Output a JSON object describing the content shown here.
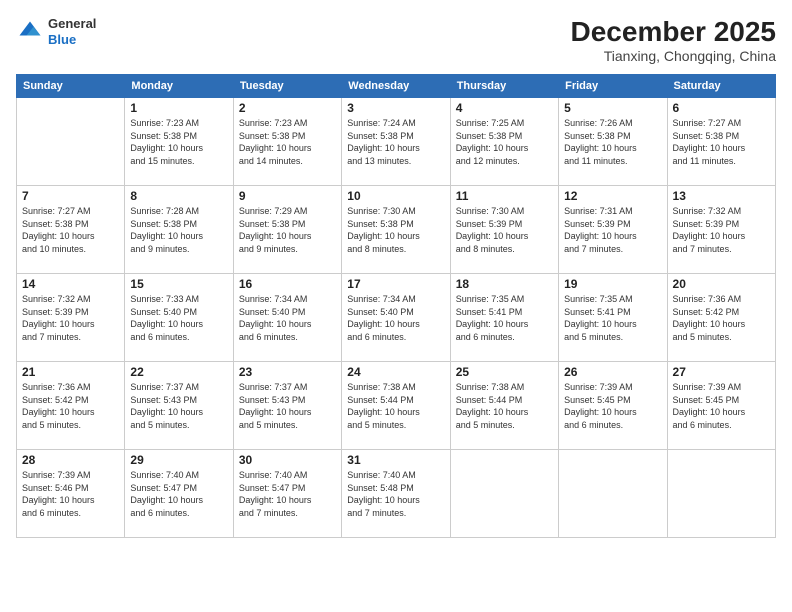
{
  "header": {
    "logo_line1": "General",
    "logo_line2": "Blue",
    "main_title": "December 2025",
    "sub_title": "Tianxing, Chongqing, China"
  },
  "days_of_week": [
    "Sunday",
    "Monday",
    "Tuesday",
    "Wednesday",
    "Thursday",
    "Friday",
    "Saturday"
  ],
  "weeks": [
    [
      {
        "day": "",
        "info": ""
      },
      {
        "day": "1",
        "info": "Sunrise: 7:23 AM\nSunset: 5:38 PM\nDaylight: 10 hours\nand 15 minutes."
      },
      {
        "day": "2",
        "info": "Sunrise: 7:23 AM\nSunset: 5:38 PM\nDaylight: 10 hours\nand 14 minutes."
      },
      {
        "day": "3",
        "info": "Sunrise: 7:24 AM\nSunset: 5:38 PM\nDaylight: 10 hours\nand 13 minutes."
      },
      {
        "day": "4",
        "info": "Sunrise: 7:25 AM\nSunset: 5:38 PM\nDaylight: 10 hours\nand 12 minutes."
      },
      {
        "day": "5",
        "info": "Sunrise: 7:26 AM\nSunset: 5:38 PM\nDaylight: 10 hours\nand 11 minutes."
      },
      {
        "day": "6",
        "info": "Sunrise: 7:27 AM\nSunset: 5:38 PM\nDaylight: 10 hours\nand 11 minutes."
      }
    ],
    [
      {
        "day": "7",
        "info": "Sunrise: 7:27 AM\nSunset: 5:38 PM\nDaylight: 10 hours\nand 10 minutes."
      },
      {
        "day": "8",
        "info": "Sunrise: 7:28 AM\nSunset: 5:38 PM\nDaylight: 10 hours\nand 9 minutes."
      },
      {
        "day": "9",
        "info": "Sunrise: 7:29 AM\nSunset: 5:38 PM\nDaylight: 10 hours\nand 9 minutes."
      },
      {
        "day": "10",
        "info": "Sunrise: 7:30 AM\nSunset: 5:38 PM\nDaylight: 10 hours\nand 8 minutes."
      },
      {
        "day": "11",
        "info": "Sunrise: 7:30 AM\nSunset: 5:39 PM\nDaylight: 10 hours\nand 8 minutes."
      },
      {
        "day": "12",
        "info": "Sunrise: 7:31 AM\nSunset: 5:39 PM\nDaylight: 10 hours\nand 7 minutes."
      },
      {
        "day": "13",
        "info": "Sunrise: 7:32 AM\nSunset: 5:39 PM\nDaylight: 10 hours\nand 7 minutes."
      }
    ],
    [
      {
        "day": "14",
        "info": "Sunrise: 7:32 AM\nSunset: 5:39 PM\nDaylight: 10 hours\nand 7 minutes."
      },
      {
        "day": "15",
        "info": "Sunrise: 7:33 AM\nSunset: 5:40 PM\nDaylight: 10 hours\nand 6 minutes."
      },
      {
        "day": "16",
        "info": "Sunrise: 7:34 AM\nSunset: 5:40 PM\nDaylight: 10 hours\nand 6 minutes."
      },
      {
        "day": "17",
        "info": "Sunrise: 7:34 AM\nSunset: 5:40 PM\nDaylight: 10 hours\nand 6 minutes."
      },
      {
        "day": "18",
        "info": "Sunrise: 7:35 AM\nSunset: 5:41 PM\nDaylight: 10 hours\nand 6 minutes."
      },
      {
        "day": "19",
        "info": "Sunrise: 7:35 AM\nSunset: 5:41 PM\nDaylight: 10 hours\nand 5 minutes."
      },
      {
        "day": "20",
        "info": "Sunrise: 7:36 AM\nSunset: 5:42 PM\nDaylight: 10 hours\nand 5 minutes."
      }
    ],
    [
      {
        "day": "21",
        "info": "Sunrise: 7:36 AM\nSunset: 5:42 PM\nDaylight: 10 hours\nand 5 minutes."
      },
      {
        "day": "22",
        "info": "Sunrise: 7:37 AM\nSunset: 5:43 PM\nDaylight: 10 hours\nand 5 minutes."
      },
      {
        "day": "23",
        "info": "Sunrise: 7:37 AM\nSunset: 5:43 PM\nDaylight: 10 hours\nand 5 minutes."
      },
      {
        "day": "24",
        "info": "Sunrise: 7:38 AM\nSunset: 5:44 PM\nDaylight: 10 hours\nand 5 minutes."
      },
      {
        "day": "25",
        "info": "Sunrise: 7:38 AM\nSunset: 5:44 PM\nDaylight: 10 hours\nand 5 minutes."
      },
      {
        "day": "26",
        "info": "Sunrise: 7:39 AM\nSunset: 5:45 PM\nDaylight: 10 hours\nand 6 minutes."
      },
      {
        "day": "27",
        "info": "Sunrise: 7:39 AM\nSunset: 5:45 PM\nDaylight: 10 hours\nand 6 minutes."
      }
    ],
    [
      {
        "day": "28",
        "info": "Sunrise: 7:39 AM\nSunset: 5:46 PM\nDaylight: 10 hours\nand 6 minutes."
      },
      {
        "day": "29",
        "info": "Sunrise: 7:40 AM\nSunset: 5:47 PM\nDaylight: 10 hours\nand 6 minutes."
      },
      {
        "day": "30",
        "info": "Sunrise: 7:40 AM\nSunset: 5:47 PM\nDaylight: 10 hours\nand 7 minutes."
      },
      {
        "day": "31",
        "info": "Sunrise: 7:40 AM\nSunset: 5:48 PM\nDaylight: 10 hours\nand 7 minutes."
      },
      {
        "day": "",
        "info": ""
      },
      {
        "day": "",
        "info": ""
      },
      {
        "day": "",
        "info": ""
      }
    ]
  ]
}
